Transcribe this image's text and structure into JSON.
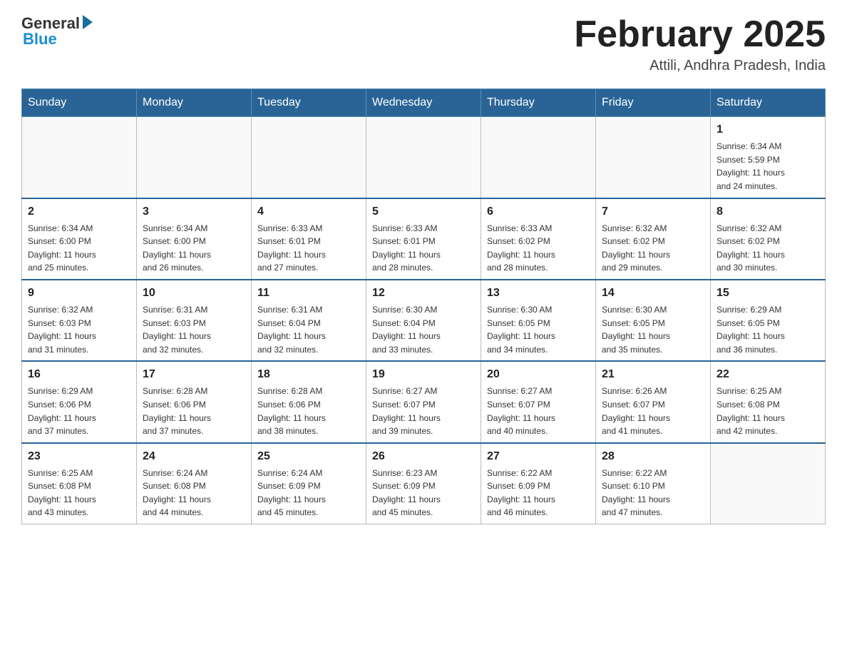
{
  "header": {
    "logo_general": "General",
    "logo_blue": "Blue",
    "month_title": "February 2025",
    "location": "Attili, Andhra Pradesh, India"
  },
  "days_of_week": [
    "Sunday",
    "Monday",
    "Tuesday",
    "Wednesday",
    "Thursday",
    "Friday",
    "Saturday"
  ],
  "weeks": [
    [
      {
        "day": "",
        "info": ""
      },
      {
        "day": "",
        "info": ""
      },
      {
        "day": "",
        "info": ""
      },
      {
        "day": "",
        "info": ""
      },
      {
        "day": "",
        "info": ""
      },
      {
        "day": "",
        "info": ""
      },
      {
        "day": "1",
        "info": "Sunrise: 6:34 AM\nSunset: 5:59 PM\nDaylight: 11 hours\nand 24 minutes."
      }
    ],
    [
      {
        "day": "2",
        "info": "Sunrise: 6:34 AM\nSunset: 6:00 PM\nDaylight: 11 hours\nand 25 minutes."
      },
      {
        "day": "3",
        "info": "Sunrise: 6:34 AM\nSunset: 6:00 PM\nDaylight: 11 hours\nand 26 minutes."
      },
      {
        "day": "4",
        "info": "Sunrise: 6:33 AM\nSunset: 6:01 PM\nDaylight: 11 hours\nand 27 minutes."
      },
      {
        "day": "5",
        "info": "Sunrise: 6:33 AM\nSunset: 6:01 PM\nDaylight: 11 hours\nand 28 minutes."
      },
      {
        "day": "6",
        "info": "Sunrise: 6:33 AM\nSunset: 6:02 PM\nDaylight: 11 hours\nand 28 minutes."
      },
      {
        "day": "7",
        "info": "Sunrise: 6:32 AM\nSunset: 6:02 PM\nDaylight: 11 hours\nand 29 minutes."
      },
      {
        "day": "8",
        "info": "Sunrise: 6:32 AM\nSunset: 6:02 PM\nDaylight: 11 hours\nand 30 minutes."
      }
    ],
    [
      {
        "day": "9",
        "info": "Sunrise: 6:32 AM\nSunset: 6:03 PM\nDaylight: 11 hours\nand 31 minutes."
      },
      {
        "day": "10",
        "info": "Sunrise: 6:31 AM\nSunset: 6:03 PM\nDaylight: 11 hours\nand 32 minutes."
      },
      {
        "day": "11",
        "info": "Sunrise: 6:31 AM\nSunset: 6:04 PM\nDaylight: 11 hours\nand 32 minutes."
      },
      {
        "day": "12",
        "info": "Sunrise: 6:30 AM\nSunset: 6:04 PM\nDaylight: 11 hours\nand 33 minutes."
      },
      {
        "day": "13",
        "info": "Sunrise: 6:30 AM\nSunset: 6:05 PM\nDaylight: 11 hours\nand 34 minutes."
      },
      {
        "day": "14",
        "info": "Sunrise: 6:30 AM\nSunset: 6:05 PM\nDaylight: 11 hours\nand 35 minutes."
      },
      {
        "day": "15",
        "info": "Sunrise: 6:29 AM\nSunset: 6:05 PM\nDaylight: 11 hours\nand 36 minutes."
      }
    ],
    [
      {
        "day": "16",
        "info": "Sunrise: 6:29 AM\nSunset: 6:06 PM\nDaylight: 11 hours\nand 37 minutes."
      },
      {
        "day": "17",
        "info": "Sunrise: 6:28 AM\nSunset: 6:06 PM\nDaylight: 11 hours\nand 37 minutes."
      },
      {
        "day": "18",
        "info": "Sunrise: 6:28 AM\nSunset: 6:06 PM\nDaylight: 11 hours\nand 38 minutes."
      },
      {
        "day": "19",
        "info": "Sunrise: 6:27 AM\nSunset: 6:07 PM\nDaylight: 11 hours\nand 39 minutes."
      },
      {
        "day": "20",
        "info": "Sunrise: 6:27 AM\nSunset: 6:07 PM\nDaylight: 11 hours\nand 40 minutes."
      },
      {
        "day": "21",
        "info": "Sunrise: 6:26 AM\nSunset: 6:07 PM\nDaylight: 11 hours\nand 41 minutes."
      },
      {
        "day": "22",
        "info": "Sunrise: 6:25 AM\nSunset: 6:08 PM\nDaylight: 11 hours\nand 42 minutes."
      }
    ],
    [
      {
        "day": "23",
        "info": "Sunrise: 6:25 AM\nSunset: 6:08 PM\nDaylight: 11 hours\nand 43 minutes."
      },
      {
        "day": "24",
        "info": "Sunrise: 6:24 AM\nSunset: 6:08 PM\nDaylight: 11 hours\nand 44 minutes."
      },
      {
        "day": "25",
        "info": "Sunrise: 6:24 AM\nSunset: 6:09 PM\nDaylight: 11 hours\nand 45 minutes."
      },
      {
        "day": "26",
        "info": "Sunrise: 6:23 AM\nSunset: 6:09 PM\nDaylight: 11 hours\nand 45 minutes."
      },
      {
        "day": "27",
        "info": "Sunrise: 6:22 AM\nSunset: 6:09 PM\nDaylight: 11 hours\nand 46 minutes."
      },
      {
        "day": "28",
        "info": "Sunrise: 6:22 AM\nSunset: 6:10 PM\nDaylight: 11 hours\nand 47 minutes."
      },
      {
        "day": "",
        "info": ""
      }
    ]
  ]
}
